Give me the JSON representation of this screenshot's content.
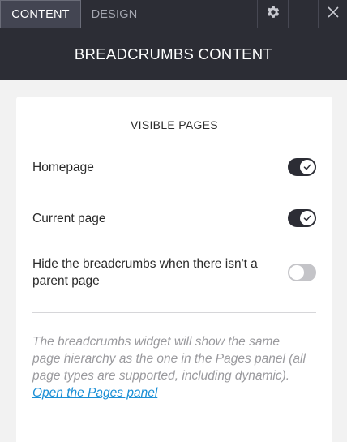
{
  "tabs": {
    "content_label": "CONTENT",
    "design_label": "DESIGN"
  },
  "icons": {
    "settings": "gear-icon",
    "close": "close-icon",
    "toggle_check": "check-icon"
  },
  "header": {
    "title": "BREADCRUMBS CONTENT"
  },
  "visible_pages": {
    "title": "VISIBLE PAGES",
    "options": [
      {
        "label": "Homepage",
        "enabled": true
      },
      {
        "label": "Current page",
        "enabled": true
      },
      {
        "label": "Hide the breadcrumbs when there isn't a parent page",
        "enabled": false
      }
    ]
  },
  "help": {
    "text": "The breadcrumbs widget will show the same page hierarchy as the one in the Pages panel (all page types are supported, including dynamic). ",
    "link_label": "Open the Pages panel"
  },
  "colors": {
    "dark_bg": "#2c2d35",
    "active_tab": "#434552",
    "toggle_on": "#2c2d35",
    "toggle_off": "#c4c4c8",
    "link": "#1a8fd6"
  }
}
